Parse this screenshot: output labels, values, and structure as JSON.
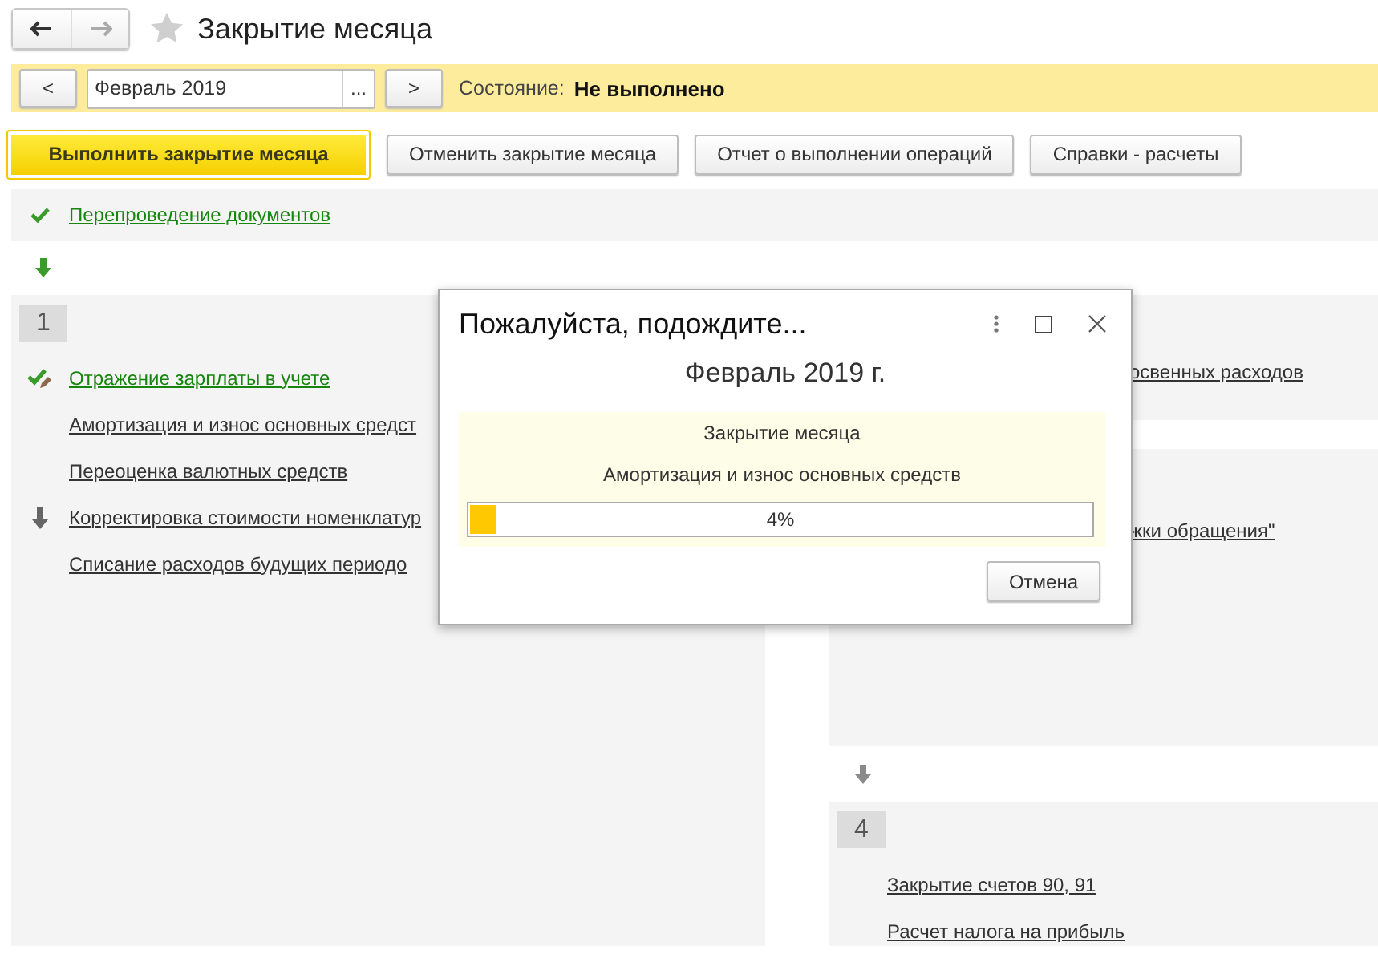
{
  "title": "Закрытие месяца",
  "favorite": false,
  "period_bar": {
    "prev": "<",
    "period": "Февраль 2019",
    "choose": "...",
    "next": ">",
    "state_label": "Состояние:",
    "state_value": "Не выполнено"
  },
  "buttons": [
    {
      "label": "Выполнить закрытие месяца",
      "primary": true
    },
    {
      "label": "Отменить закрытие месяца",
      "primary": false
    },
    {
      "label": "Отчет о выполнении операций",
      "primary": false
    },
    {
      "label": "Справки - расчеты",
      "primary": false
    }
  ],
  "top_step": {
    "label": "Перепроведение документов",
    "done": true
  },
  "top_arrow": {
    "done": true
  },
  "columns": [
    {
      "sections": [
        {
          "number": "1",
          "items": [
            {
              "label": "Отражение зарплаты в учете",
              "done": true,
              "edited": true,
              "pending": false
            },
            {
              "label": "Амортизация и износ основных средст",
              "done": false,
              "edited": false,
              "pending": false
            },
            {
              "label": "Переоценка валютных средств",
              "done": false,
              "edited": false,
              "pending": false
            },
            {
              "label": "Корректировка стоимости номенклатур",
              "done": false,
              "edited": false,
              "pending": true
            },
            {
              "label": "Списание расходов будущих периодо",
              "done": false,
              "edited": false,
              "pending": false
            }
          ]
        }
      ]
    },
    {
      "sections": [
        {
          "items": [
            {
              "label": "освенных расходов"
            }
          ]
        },
        {
          "items": [
            {
              "label": "жки обращения\""
            }
          ]
        },
        {
          "arrow_above": {
            "done": false
          },
          "number": "4",
          "items": [
            {
              "label": "Закрытие счетов 90, 91",
              "done": false,
              "edited": false,
              "pending": false
            },
            {
              "label": "Расчет налога на прибыль",
              "done": false,
              "edited": false,
              "pending": false
            }
          ]
        }
      ]
    }
  ],
  "dialog": {
    "title": "Пожалуйста, подождите...",
    "heading": "Февраль 2019 г.",
    "operation": "Закрытие месяца",
    "step": "Амортизация и износ основных средств",
    "level": 0.04,
    "reading": "4%",
    "cancel": "Отмена"
  }
}
